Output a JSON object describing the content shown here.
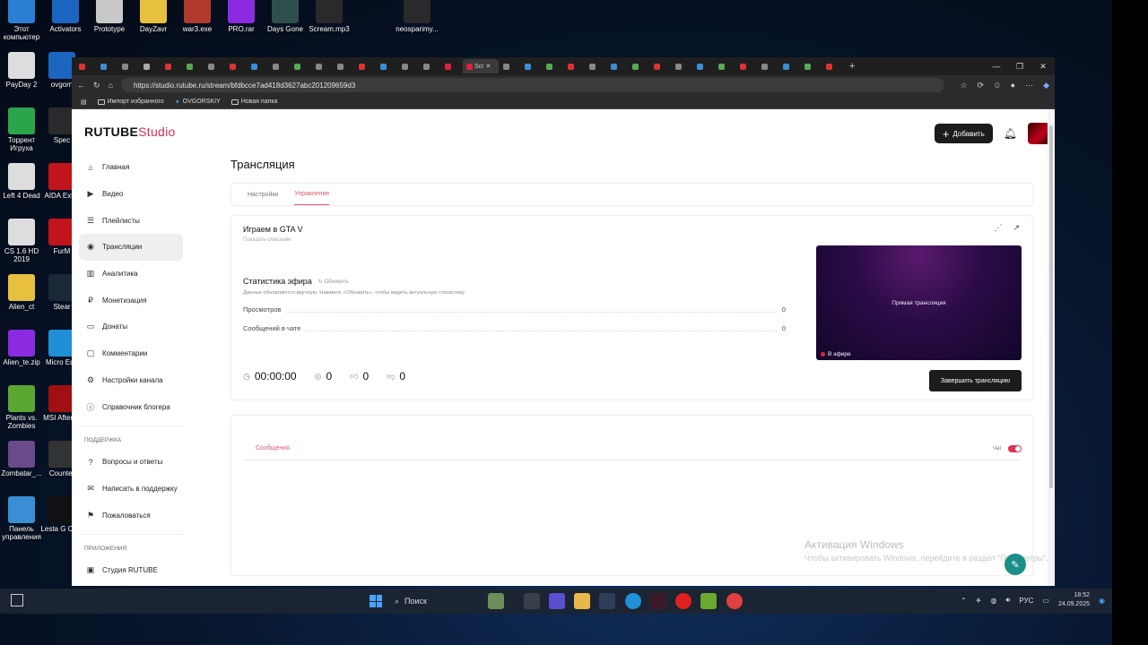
{
  "desktop": {
    "icons": [
      {
        "label": "Этот компьютер",
        "color": "#2a7fd4"
      },
      {
        "label": "Activators",
        "color": "#1a66c0"
      },
      {
        "label": "Prototype",
        "color": "#c9c9c9"
      },
      {
        "label": "DayZavr",
        "color": "#e8c040"
      },
      {
        "label": "war3.exe",
        "color": "#b03a2e"
      },
      {
        "label": "PRO.rar",
        "color": "#8a2be2"
      },
      {
        "label": "Days Gone",
        "color": "#2f4f4f"
      },
      {
        "label": "Scream.mp3",
        "color": "#2a2a2a"
      },
      {
        "label": "neosparimy...",
        "color": "#2a2a2a"
      },
      {
        "label": "PayDay 2",
        "color": "#dddddd"
      },
      {
        "label": "ovgorn",
        "color": "#1a66c0"
      },
      {
        "label": "Торрент Игруха",
        "color": "#2ca44b"
      },
      {
        "label": "Spec",
        "color": "#2a2a2a"
      },
      {
        "label": "Left 4 Dead",
        "color": "#dddddd"
      },
      {
        "label": "AIDA Extre",
        "color": "#c0161b"
      },
      {
        "label": "CS 1.6 HD 2019",
        "color": "#dddddd"
      },
      {
        "label": "FurM",
        "color": "#c0161b"
      },
      {
        "label": "Alien_ct",
        "color": "#e8c040"
      },
      {
        "label": "Stear",
        "color": "#1b2838"
      },
      {
        "label": "Alien_te.zip",
        "color": "#8a2be2"
      },
      {
        "label": "Micro Edg",
        "color": "#1f8fd6"
      },
      {
        "label": "Plants vs. Zombies",
        "color": "#5aa832"
      },
      {
        "label": "MSI Afterbu",
        "color": "#a01010"
      },
      {
        "label": "Zombatar_...",
        "color": "#6a4a8a"
      },
      {
        "label": "Counter",
        "color": "#333333"
      },
      {
        "label": "Панель управления",
        "color": "#3a8fd4"
      },
      {
        "label": "Lesta G Cent",
        "color": "#111111"
      }
    ]
  },
  "browser": {
    "active_tab_label": "Scr",
    "url": "https://studio.rutube.ru/stream/bfdbcce7ad418d3627abc201209659d3",
    "bookmarks": [
      "Импорт избранного",
      "OVGORSKIY",
      "Новая папка"
    ]
  },
  "app": {
    "logo_main": "RUTUBE",
    "logo_suffix": "Studio",
    "add_button": "Добавить",
    "nav": [
      {
        "label": "Главная",
        "icon": "home-icon",
        "glyph": "⌂"
      },
      {
        "label": "Видео",
        "icon": "video-icon",
        "glyph": "▶"
      },
      {
        "label": "Плейлисты",
        "icon": "playlist-icon",
        "glyph": "☰"
      },
      {
        "label": "Трансляции",
        "icon": "broadcast-icon",
        "glyph": "◉"
      },
      {
        "label": "Аналитика",
        "icon": "analytics-icon",
        "glyph": "▥"
      },
      {
        "label": "Монетизация",
        "icon": "monetization-icon",
        "glyph": "₽"
      },
      {
        "label": "Донаты",
        "icon": "donate-icon",
        "glyph": "▭"
      },
      {
        "label": "Комментарии",
        "icon": "comments-icon",
        "glyph": "▢"
      },
      {
        "label": "Настройки канала",
        "icon": "settings-icon",
        "glyph": "⚙"
      },
      {
        "label": "Справочник блогера",
        "icon": "info-icon",
        "glyph": "ⓘ"
      }
    ],
    "support_section": "ПОДДЕРЖКА",
    "support_nav": [
      {
        "label": "Вопросы и ответы",
        "icon": "faq-icon",
        "glyph": "?"
      },
      {
        "label": "Написать в поддержку",
        "icon": "mail-icon",
        "glyph": "✉"
      },
      {
        "label": "Пожаловаться",
        "icon": "flag-icon",
        "glyph": "⚑"
      }
    ],
    "apps_section": "ПРИЛОЖЕНИЯ",
    "apps_nav": [
      {
        "label": "Студия RUTUBE",
        "icon": "studio-icon",
        "glyph": "▣"
      }
    ],
    "page_title": "Трансляция",
    "tabs": [
      "Настройки",
      "Управление"
    ],
    "stream": {
      "title": "Играем в GTA V",
      "show_description": "Показать описание",
      "stats_title": "Статистика эфира",
      "refresh": "Обновить",
      "stats_note": "Данные обновляются вручную. Нажмите «Обновить», чтобы видеть актуальную статистику",
      "stats": [
        {
          "label": "Просмотров",
          "value": "0"
        },
        {
          "label": "Сообщений в чате",
          "value": "0"
        }
      ],
      "duration": "00:00:00",
      "viewers": "0",
      "likes": "0",
      "dislikes": "0",
      "preview_label": "Прямая трансляция",
      "live_badge": "В эфире",
      "end_button": "Завершить трансляцию"
    },
    "chat": {
      "tab": "Сообщения",
      "toggle_label": "Чат"
    }
  },
  "overlay": {
    "activation_title": "Активация Windows",
    "activation_text": "Чтобы активировать Windows, перейдите в раздел \"Параметры\"."
  },
  "taskbar": {
    "search": "Поиск",
    "lang": "РУС",
    "time": "18:52",
    "date": "24.09.2025"
  }
}
